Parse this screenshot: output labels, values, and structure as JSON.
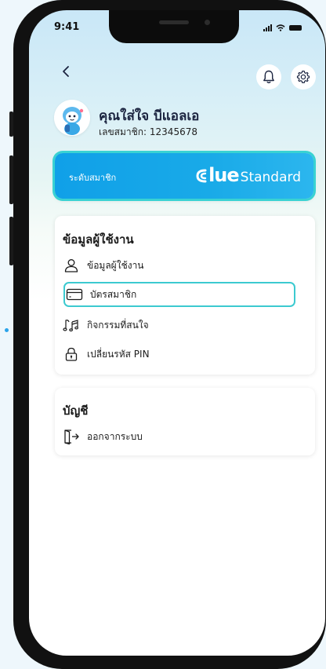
{
  "status_bar": {
    "time": "9:41"
  },
  "header": {
    "back_icon": "chevron-left-icon",
    "notification_icon": "bell-icon",
    "settings_icon": "gear-icon"
  },
  "profile": {
    "name": "คุณใส่ใจ บีแอลเอ",
    "member_id": "เลขสมาชิก: 12345678",
    "avatar_icon": "mascot-avatar"
  },
  "tier": {
    "label": "ระดับสมาชิก",
    "brand": "\u0001lue",
    "level": "Standard",
    "colors": {
      "card": "#10a0e8",
      "highlight": "#39d2d2"
    }
  },
  "user_section": {
    "title": "ข้อมูลผู้ใช้งาน",
    "items": [
      {
        "label": "ข้อมูลผู้ใช้งาน",
        "icon": "user-icon"
      },
      {
        "label": "บัตรสมาชิก",
        "icon": "card-icon",
        "selected": true
      },
      {
        "label": "กิจกรรมที่สนใจ",
        "icon": "music-icon"
      },
      {
        "label": "เปลี่ยนรหัส PIN",
        "icon": "lock-icon"
      }
    ]
  },
  "account_section": {
    "title": "บัญชี",
    "items": [
      {
        "label": "ออกจากระบบ",
        "icon": "logout-icon"
      }
    ]
  }
}
